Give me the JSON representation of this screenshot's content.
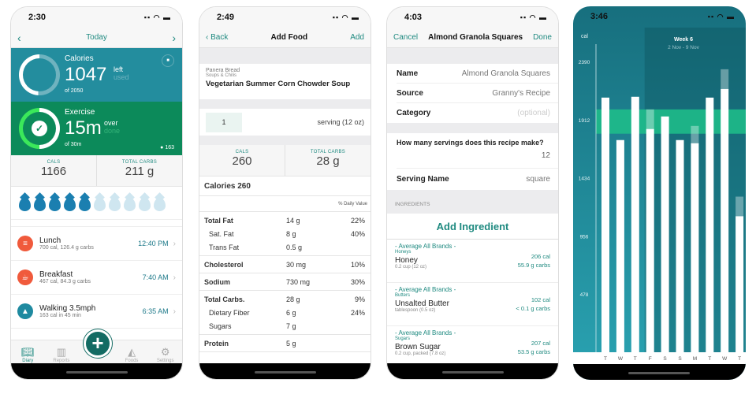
{
  "diary": {
    "status_time": "2:30",
    "nav": {
      "prev": "‹",
      "title": "Today",
      "next": "›"
    },
    "calories": {
      "title": "Calories",
      "value": "1047",
      "left": "left",
      "used": "used",
      "of": "of 2050",
      "progress": 0.49
    },
    "exercise": {
      "title": "Exercise",
      "value": "15m",
      "over": "over",
      "done": "done",
      "of": "of 30m",
      "burned": "163",
      "progress": 1.0
    },
    "stats": [
      {
        "label": "CALS",
        "value": "1166"
      },
      {
        "label": "TOTAL CARBS",
        "value": "211 g"
      }
    ],
    "water": {
      "filled": 5,
      "total": 10
    },
    "entries": [
      {
        "name": "Lunch",
        "detail": "700 cal, 126.4 g carbs",
        "time": "12:40 PM",
        "icon": "burger-icon",
        "color": "#f05a3c"
      },
      {
        "name": "Breakfast",
        "detail": "467 cal, 84.3 g carbs",
        "time": "7:40 AM",
        "icon": "coffee-cup-icon",
        "color": "#f05a3c"
      },
      {
        "name": "Walking 3.5mph",
        "detail": "163 cal in 45 min",
        "time": "6:35 AM",
        "icon": "flame-icon",
        "color": "#1f8aa0"
      }
    ],
    "tabs": [
      {
        "label": "Diary",
        "icon": "book-icon",
        "active": true
      },
      {
        "label": "Reports",
        "icon": "bar-chart-icon"
      },
      {
        "label": "Foods",
        "icon": "cake-icon"
      },
      {
        "label": "Settings",
        "icon": "gear-icon"
      }
    ]
  },
  "add_food": {
    "status_time": "2:49",
    "nav": {
      "back": "Back",
      "title": "Add Food",
      "add": "Add"
    },
    "brand": "Panera Bread",
    "category": "Soups & Chilis",
    "name": "Vegetarian Summer Corn Chowder Soup",
    "quantity": "1",
    "serving": "serving (12 oz)",
    "stats": [
      {
        "label": "CALS",
        "value": "260"
      },
      {
        "label": "TOTAL CARBS",
        "value": "28 g"
      }
    ],
    "calories_line": "Calories 260",
    "daily_value_header": "% Daily Value",
    "groups": [
      [
        {
          "name": "Total Fat",
          "amount": "14 g",
          "pct": "22%",
          "bold": true
        },
        {
          "name": "Sat. Fat",
          "amount": "8 g",
          "pct": "40%"
        },
        {
          "name": "Trans Fat",
          "amount": "0.5 g",
          "pct": ""
        }
      ],
      [
        {
          "name": "Cholesterol",
          "amount": "30 mg",
          "pct": "10%",
          "bold": true
        }
      ],
      [
        {
          "name": "Sodium",
          "amount": "730 mg",
          "pct": "30%",
          "bold": true
        }
      ],
      [
        {
          "name": "Total Carbs.",
          "amount": "28 g",
          "pct": "9%",
          "bold": true
        },
        {
          "name": "Dietary Fiber",
          "amount": "6 g",
          "pct": "24%"
        },
        {
          "name": "Sugars",
          "amount": "7 g",
          "pct": ""
        }
      ],
      [
        {
          "name": "Protein",
          "amount": "5 g",
          "pct": "",
          "bold": true
        }
      ]
    ]
  },
  "recipe": {
    "status_time": "4:03",
    "nav": {
      "cancel": "Cancel",
      "title": "Almond Granola Squares",
      "done": "Done"
    },
    "fields": [
      {
        "label": "Name",
        "value": "Almond Granola Squares"
      },
      {
        "label": "Source",
        "value": "Granny's Recipe"
      },
      {
        "label": "Category",
        "placeholder": "(optional)"
      }
    ],
    "servings_question": "How many servings does this recipe make?",
    "servings": "12",
    "serving_name_label": "Serving Name",
    "serving_name": "square",
    "ingredients_header": "INGREDIENTS",
    "add_ingredient": "Add Ingredient",
    "ingredients": [
      {
        "brand": "- Average All Brands -",
        "category": "Honeys",
        "name": "Honey",
        "serving": "0.2 cup (12 oz)",
        "cal": "206 cal",
        "carbs": "55.9 g carbs"
      },
      {
        "brand": "- Average All Brands -",
        "category": "Butters",
        "name": "Unsalted Butter",
        "serving": "tablespoon (0.5 oz)",
        "cal": "102 cal",
        "carbs": "< 0.1 g carbs"
      },
      {
        "brand": "- Average All Brands -",
        "category": "Sugars",
        "name": "Brown Sugar",
        "serving": "0.2 cup, packed (7.8 oz)",
        "cal": "207 cal",
        "carbs": "53.5 g carbs"
      }
    ]
  },
  "reports": {
    "status_time": "3:46",
    "colors": {
      "bg_top": "#176f7e",
      "bg_bottom": "#2aa3b2",
      "band": "#1fc08a",
      "bar": "#ffffff"
    }
  },
  "chart_data": {
    "type": "bar",
    "ylabel": "cal",
    "yticks": [
      478,
      956,
      1434,
      1912,
      2390
    ],
    "ylim": [
      0,
      2600
    ],
    "categories": [
      "T",
      "W",
      "T",
      "F",
      "S",
      "S",
      "M",
      "T",
      "W",
      "T"
    ],
    "values": [
      2093,
      1744,
      2100,
      1835,
      1938,
      1744,
      1718,
      2093,
      2164,
      1118
    ],
    "faded_totals": [
      null,
      null,
      null,
      1996,
      null,
      null,
      1860,
      null,
      2326,
      1279
    ],
    "target_band": [
      1796,
      1996
    ],
    "highlight": {
      "title": "Week 6",
      "subtitle": "2 Nov - 9 Nov",
      "start_index": 3
    }
  }
}
